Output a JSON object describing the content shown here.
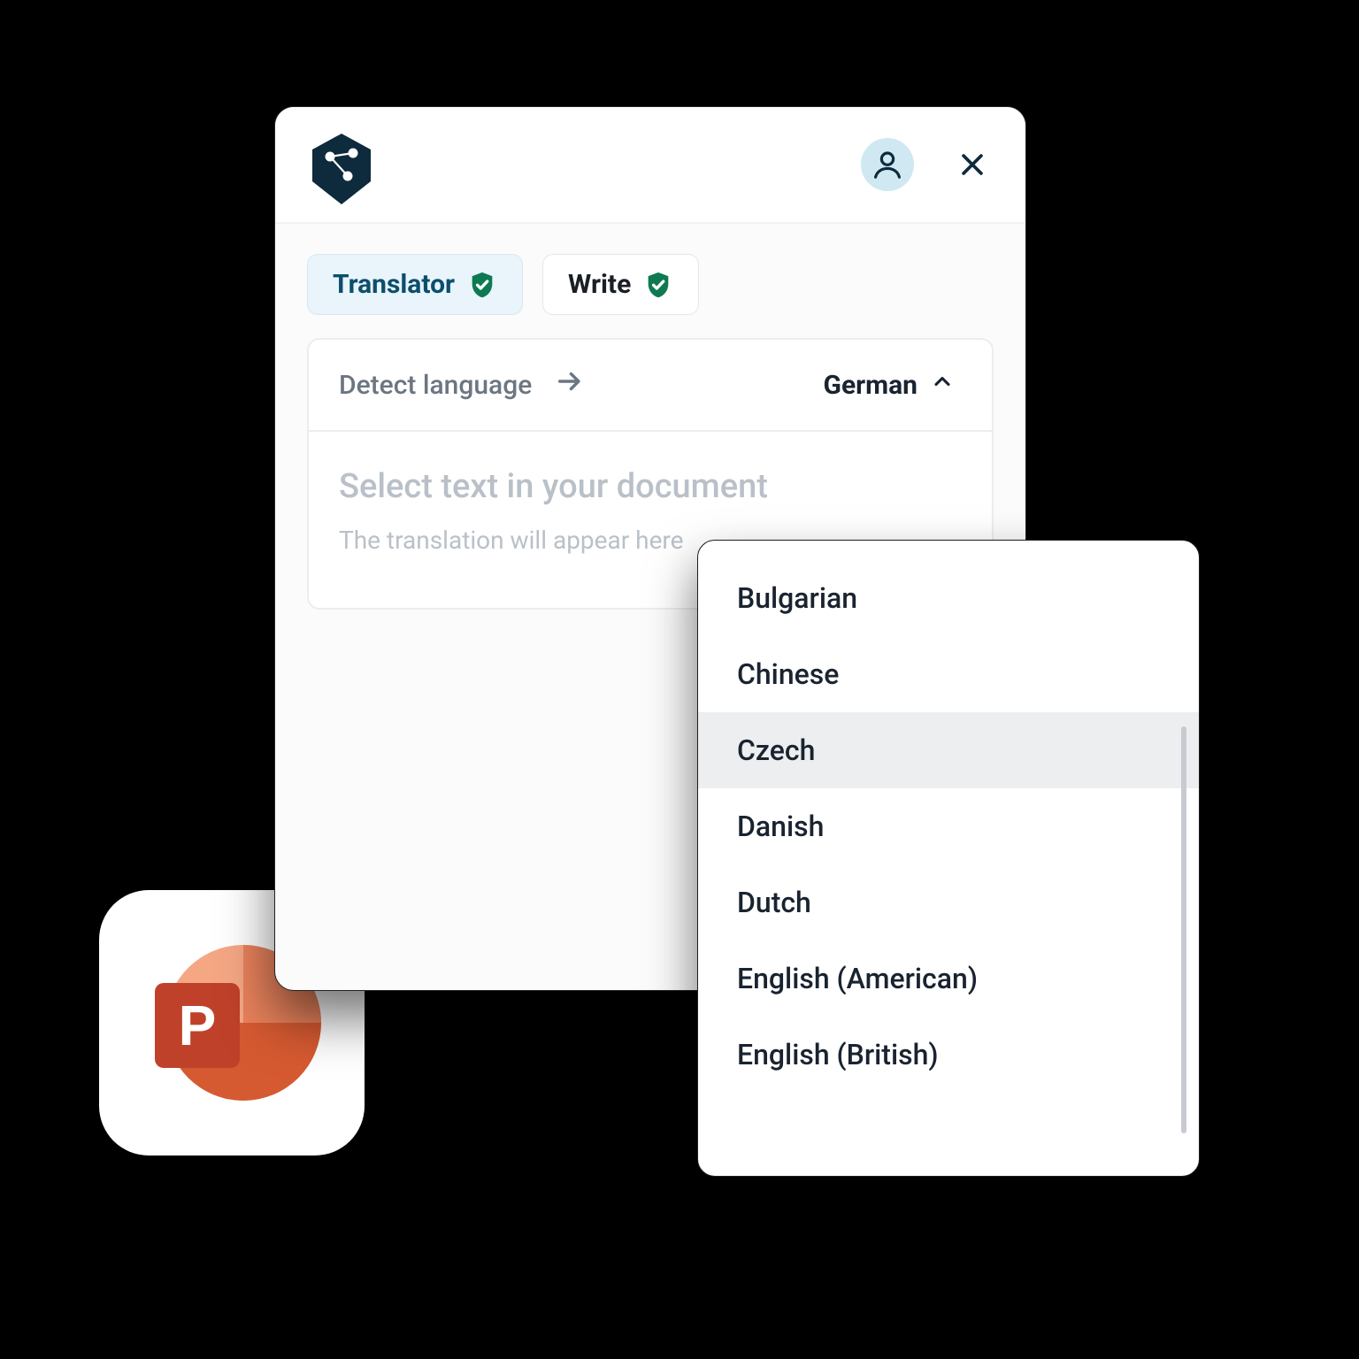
{
  "header": {
    "logo_name": "deepl-logo"
  },
  "tabs": {
    "translator": "Translator",
    "write": "Write"
  },
  "lang": {
    "detect": "Detect language",
    "target": "German"
  },
  "placeholder": {
    "main": "Select text in your document",
    "sub": "The translation will appear here"
  },
  "dropdown": {
    "items": [
      "Bulgarian",
      "Chinese",
      "Czech",
      "Danish",
      "Dutch",
      "English (American)",
      "English (British)"
    ],
    "highlighted_index": 2
  },
  "external": {
    "app_letter": "P",
    "app_name": "PowerPoint"
  }
}
